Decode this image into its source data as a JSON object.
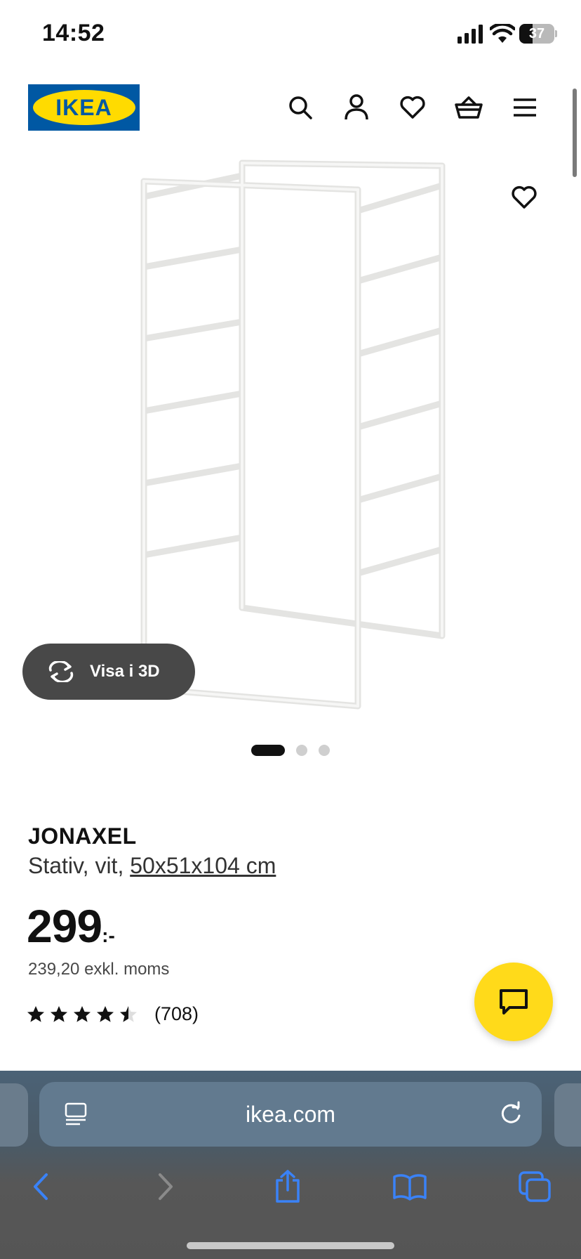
{
  "status_bar": {
    "time": "14:52",
    "battery_level": "37",
    "icons": [
      "signal-icon",
      "wifi-icon",
      "battery-icon"
    ]
  },
  "header": {
    "logo_text": "IKEA",
    "icons": [
      "search-icon",
      "account-icon",
      "heart-icon",
      "basket-icon",
      "menu-icon"
    ]
  },
  "gallery": {
    "view_3d_label": "Visa i 3D",
    "page_count": 3,
    "current_page": 1
  },
  "product": {
    "name": "JONAXEL",
    "description": "Stativ, vit, ",
    "size": "50x51x104 cm",
    "price": "299",
    "price_suffix": ":-",
    "price_ex_vat": "239,20 exkl. moms",
    "rating": 4.5,
    "rating_max": 5,
    "review_count": "(708)"
  },
  "browser": {
    "url": "ikea.com",
    "icons": [
      "reader-icon",
      "reload-icon",
      "back-icon",
      "forward-icon",
      "share-icon",
      "bookmarks-icon",
      "tabs-icon"
    ]
  },
  "colors": {
    "ikea_blue": "#0058a3",
    "ikea_yellow": "#ffdb00",
    "chat_yellow": "#ffda1a",
    "ios_blue": "#3a82f7"
  }
}
